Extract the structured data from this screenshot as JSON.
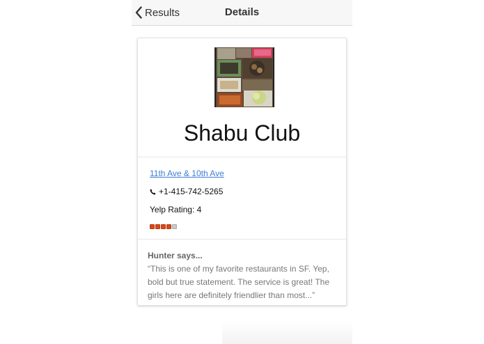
{
  "nav": {
    "back_label": "Results",
    "title": "Details"
  },
  "business": {
    "name": "Shabu Club",
    "address": "11th Ave & 10th Ave",
    "phone": "+1-415-742-5265",
    "rating_label": "Yelp Rating: 4",
    "rating_value": 4,
    "rating_max": 5
  },
  "review": {
    "author": "Hunter says...",
    "text": "“This is one of my favorite restaurants in SF. Yep, bold but true statement. The service is great! The girls here are definitely friendlier than most...”"
  },
  "colors": {
    "link": "#3b7dd8",
    "star_on": "#d5491a",
    "navbar_bg": "#f7f7f7"
  },
  "icons": {
    "back": "chevron-left-icon",
    "phone": "phone-icon"
  }
}
